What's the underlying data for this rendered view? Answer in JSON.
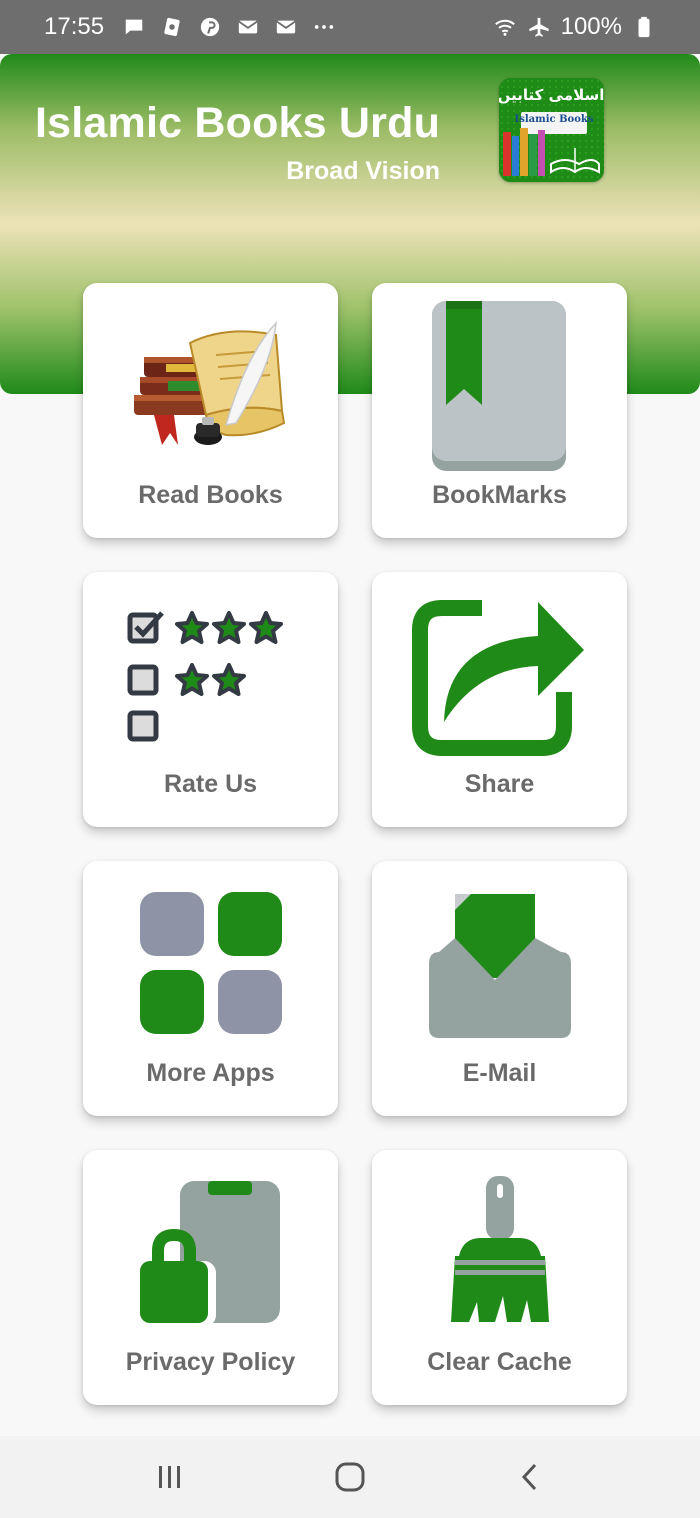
{
  "status_bar": {
    "time": "17:55",
    "battery": "100%",
    "left_icons": [
      "message-icon",
      "paw-icon",
      "pinterest-icon",
      "mail-icon",
      "mail-icon",
      "more-dots-icon"
    ],
    "right_icons": [
      "wifi-icon",
      "airplane-icon",
      "battery-icon"
    ]
  },
  "header": {
    "title": "Islamic Books Urdu",
    "subtitle": "Broad Vision",
    "logo": {
      "urdu_text": "اسلامی کتابیں",
      "english_text": "Islamic Books"
    }
  },
  "tiles": [
    {
      "label": "Read Books",
      "icon": "books-scroll-icon"
    },
    {
      "label": "BookMarks",
      "icon": "bookmark-book-icon"
    },
    {
      "label": "Rate Us",
      "icon": "rating-checklist-icon"
    },
    {
      "label": "Share",
      "icon": "share-arrow-icon"
    },
    {
      "label": "More Apps",
      "icon": "apps-grid-icon"
    },
    {
      "label": "E-Mail",
      "icon": "email-envelope-icon"
    },
    {
      "label": "Privacy Policy",
      "icon": "phone-lock-icon"
    },
    {
      "label": "Clear Cache",
      "icon": "broom-icon"
    }
  ],
  "colors": {
    "brand_green": "#1f8a17",
    "icon_gray": "#95a3a0",
    "icon_slate": "#8e93a5",
    "label_gray": "#6a6a6a"
  },
  "nav_bar": [
    "recents-icon",
    "home-icon",
    "back-icon"
  ]
}
